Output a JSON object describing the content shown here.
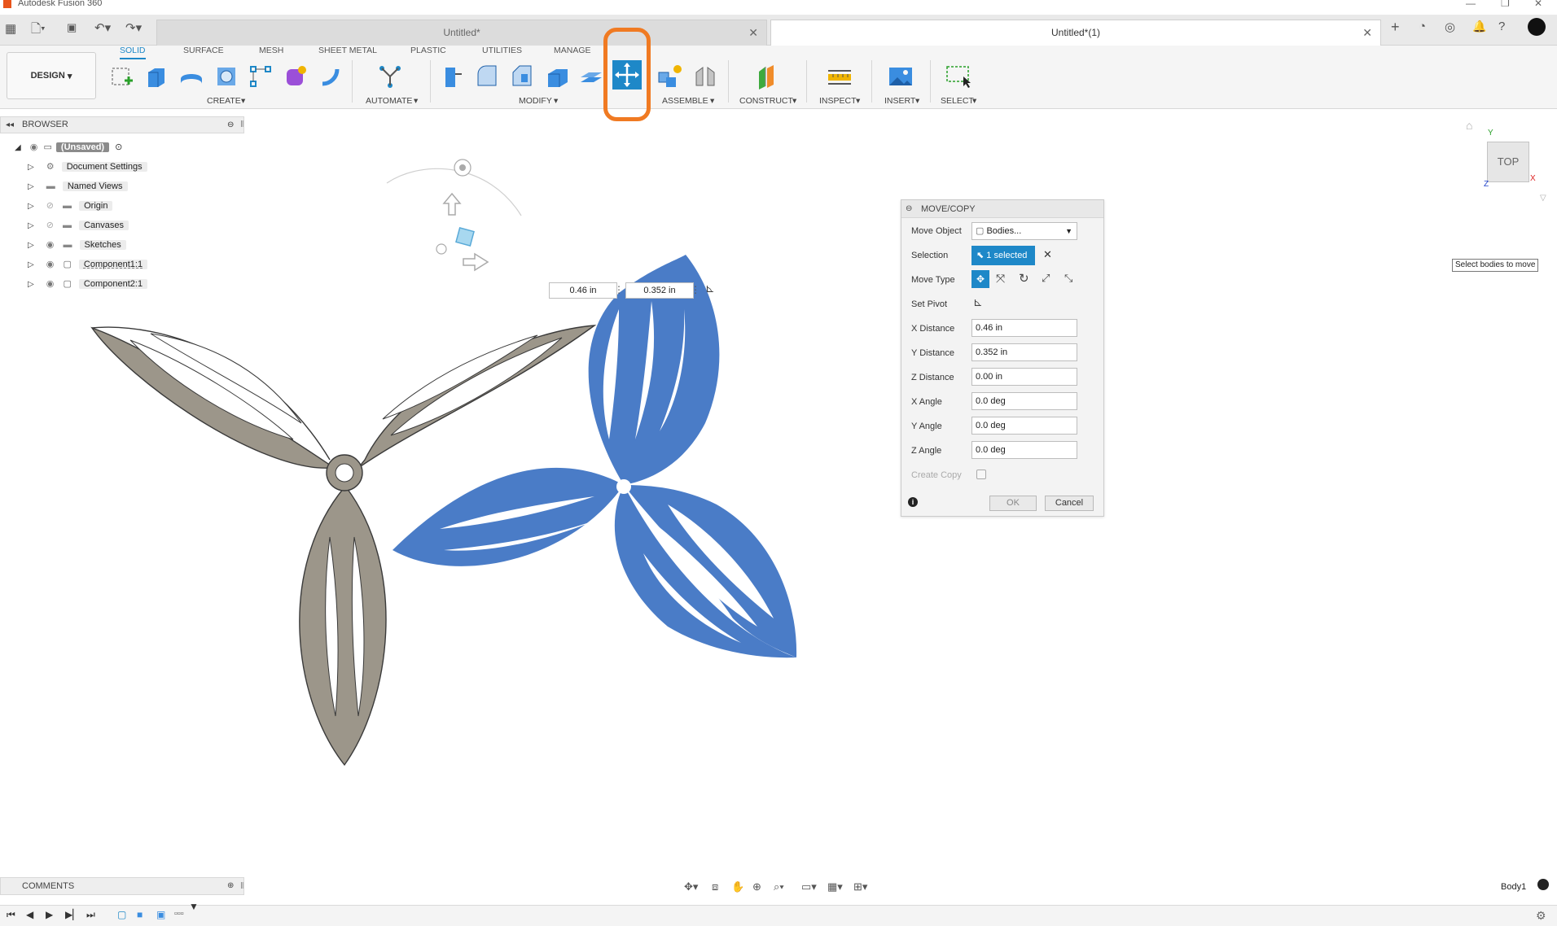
{
  "app": {
    "title": "Autodesk Fusion 360"
  },
  "tabs": [
    {
      "label": "Untitled*",
      "active": false
    },
    {
      "label": "Untitled*(1)",
      "active": true
    }
  ],
  "toolbar": {
    "workspace": "DESIGN",
    "workspace_tabs": [
      "SOLID",
      "SURFACE",
      "MESH",
      "SHEET METAL",
      "PLASTIC",
      "UTILITIES",
      "MANAGE"
    ],
    "groups": [
      "CREATE",
      "AUTOMATE",
      "MODIFY",
      "ASSEMBLE",
      "CONSTRUCT",
      "INSPECT",
      "INSERT",
      "SELECT"
    ]
  },
  "browser": {
    "title": "BROWSER",
    "root": "(Unsaved)",
    "items": [
      "Document Settings",
      "Named Views",
      "Origin",
      "Canvases",
      "Sketches",
      "Component1:1",
      "Component2:1"
    ]
  },
  "canvas": {
    "x_readout": "0.46 in",
    "y_readout": "0.352 in",
    "tooltip": "Select bodies to move",
    "viewcube": {
      "face": "TOP",
      "axis_x": "X",
      "axis_y": "Y",
      "axis_z": "Z"
    }
  },
  "dialog": {
    "title": "MOVE/COPY",
    "move_object_label": "Move Object",
    "move_object_value": "Bodies...",
    "selection_label": "Selection",
    "selection_value": "1 selected",
    "move_type_label": "Move Type",
    "set_pivot_label": "Set Pivot",
    "fields": [
      {
        "label": "X Distance",
        "value": "0.46 in"
      },
      {
        "label": "Y Distance",
        "value": "0.352 in"
      },
      {
        "label": "Z Distance",
        "value": "0.00 in"
      },
      {
        "label": "X Angle",
        "value": "0.0 deg"
      },
      {
        "label": "Y Angle",
        "value": "0.0 deg"
      },
      {
        "label": "Z Angle",
        "value": "0.0 deg"
      }
    ],
    "create_copy_label": "Create Copy",
    "ok": "OK",
    "cancel": "Cancel"
  },
  "comments": {
    "title": "COMMENTS"
  },
  "status": {
    "body": "Body1"
  },
  "colors": {
    "accent": "#1e88c8",
    "highlight": "#f07a22",
    "body_gray": "#9c968a",
    "body_blue": "#4a7cc7"
  }
}
